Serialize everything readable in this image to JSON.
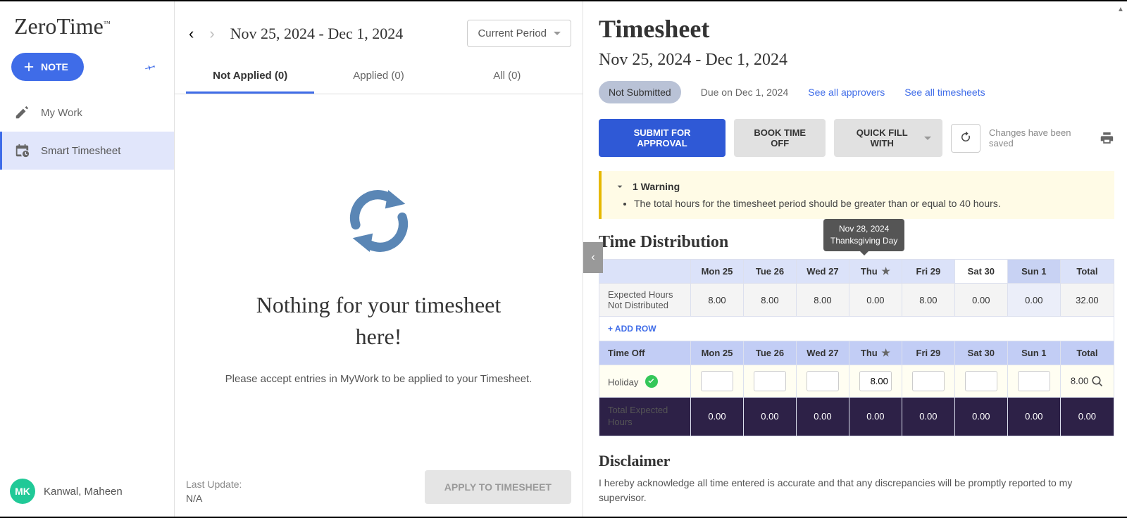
{
  "app": {
    "logo": "ZeroTime",
    "tm": "™"
  },
  "sidebar": {
    "note_button": "NOTE",
    "items": [
      {
        "label": "My Work"
      },
      {
        "label": "Smart Timesheet"
      }
    ],
    "user": {
      "initials": "MK",
      "name": "Kanwal, Maheen"
    }
  },
  "middle": {
    "period": "Nov 25, 2024 - Dec 1, 2024",
    "current_period_label": "Current Period",
    "tabs": [
      {
        "label": "Not Applied (0)"
      },
      {
        "label": "Applied (0)"
      },
      {
        "label": "All (0)"
      }
    ],
    "empty_title": "Nothing for your timesheet here!",
    "empty_sub": "Please accept entries in MyWork to be applied to your Timesheet.",
    "last_update_label": "Last Update:",
    "last_update_value": "N/A",
    "apply_btn": "APPLY TO TIMESHEET"
  },
  "right": {
    "title": "Timesheet",
    "subtitle": "Nov 25, 2024 - Dec 1, 2024",
    "status_badge": "Not Submitted",
    "due_text": "Due on Dec 1, 2024",
    "approvers_link": "See all approvers",
    "timesheets_link": "See all timesheets",
    "submit_label": "SUBMIT FOR APPROVAL",
    "book_label": "BOOK TIME OFF",
    "quick_fill_label": "QUICK FILL WITH",
    "saved_text": "Changes have been saved",
    "warning_head": "1 Warning",
    "warning_item": "The total hours for the timesheet period should be greater than or equal to 40 hours.",
    "tooltip_line1": "Nov 28, 2024",
    "tooltip_line2": "Thanksgiving Day",
    "section_title": "Time Distribution",
    "days": [
      "Mon 25",
      "Tue 26",
      "Wed 27",
      "Thu",
      "Fri 29",
      "Sat 30",
      "Sun 1",
      "Total"
    ],
    "expected_label": "Expected Hours Not Distributed",
    "expected_values": [
      "8.00",
      "8.00",
      "8.00",
      "0.00",
      "8.00",
      "0.00",
      "0.00",
      "32.00"
    ],
    "add_row": "+ ADD ROW",
    "timeoff_label": "Time Off",
    "holiday_label": "Holiday",
    "holiday_values": [
      "",
      "",
      "",
      "8.00",
      "",
      "",
      "",
      "8.00"
    ],
    "total_expected_label": "Total Expected Hours",
    "total_expected_values": [
      "0.00",
      "0.00",
      "0.00",
      "0.00",
      "0.00",
      "0.00",
      "0.00",
      "0.00"
    ],
    "disclaimer_title": "Disclaimer",
    "disclaimer_text": "I hereby acknowledge all time entered is accurate and that any discrepancies will be promptly reported to my supervisor."
  }
}
